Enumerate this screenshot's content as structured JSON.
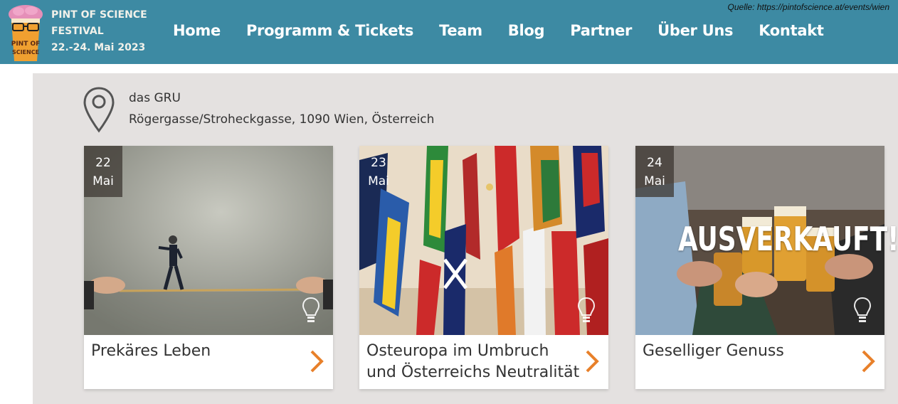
{
  "header": {
    "brand_line1": "PINT OF SCIENCE",
    "brand_line2": "FESTIVAL",
    "brand_line3": "22.-24. Mai 2023",
    "logo_text": "PINT OF SCIENCE",
    "source": "Quelle: https://pintofscience.at/events/wien",
    "nav": [
      {
        "label": "Home"
      },
      {
        "label": "Programm & Tickets"
      },
      {
        "label": "Team"
      },
      {
        "label": "Blog"
      },
      {
        "label": "Partner"
      },
      {
        "label": "Über Uns"
      },
      {
        "label": "Kontakt"
      }
    ],
    "colors": {
      "bar": "#3d8aa3",
      "accent": "#f0a030"
    }
  },
  "venue": {
    "name": "das GRU",
    "address": "Rögergasse/Stroheckgasse, 1090 Wien, Österreich",
    "icon": "map-pin-icon"
  },
  "events": [
    {
      "day": "22",
      "month": "Mai",
      "title": "Prekäres Leben",
      "sold_out": ""
    },
    {
      "day": "23",
      "month": "Mai",
      "title": "Osteuropa im Umbruch und Österreichs Neutralität",
      "sold_out": ""
    },
    {
      "day": "24",
      "month": "Mai",
      "title": "Geselliger Genuss",
      "sold_out": "AUSVERKAUFT!"
    }
  ]
}
